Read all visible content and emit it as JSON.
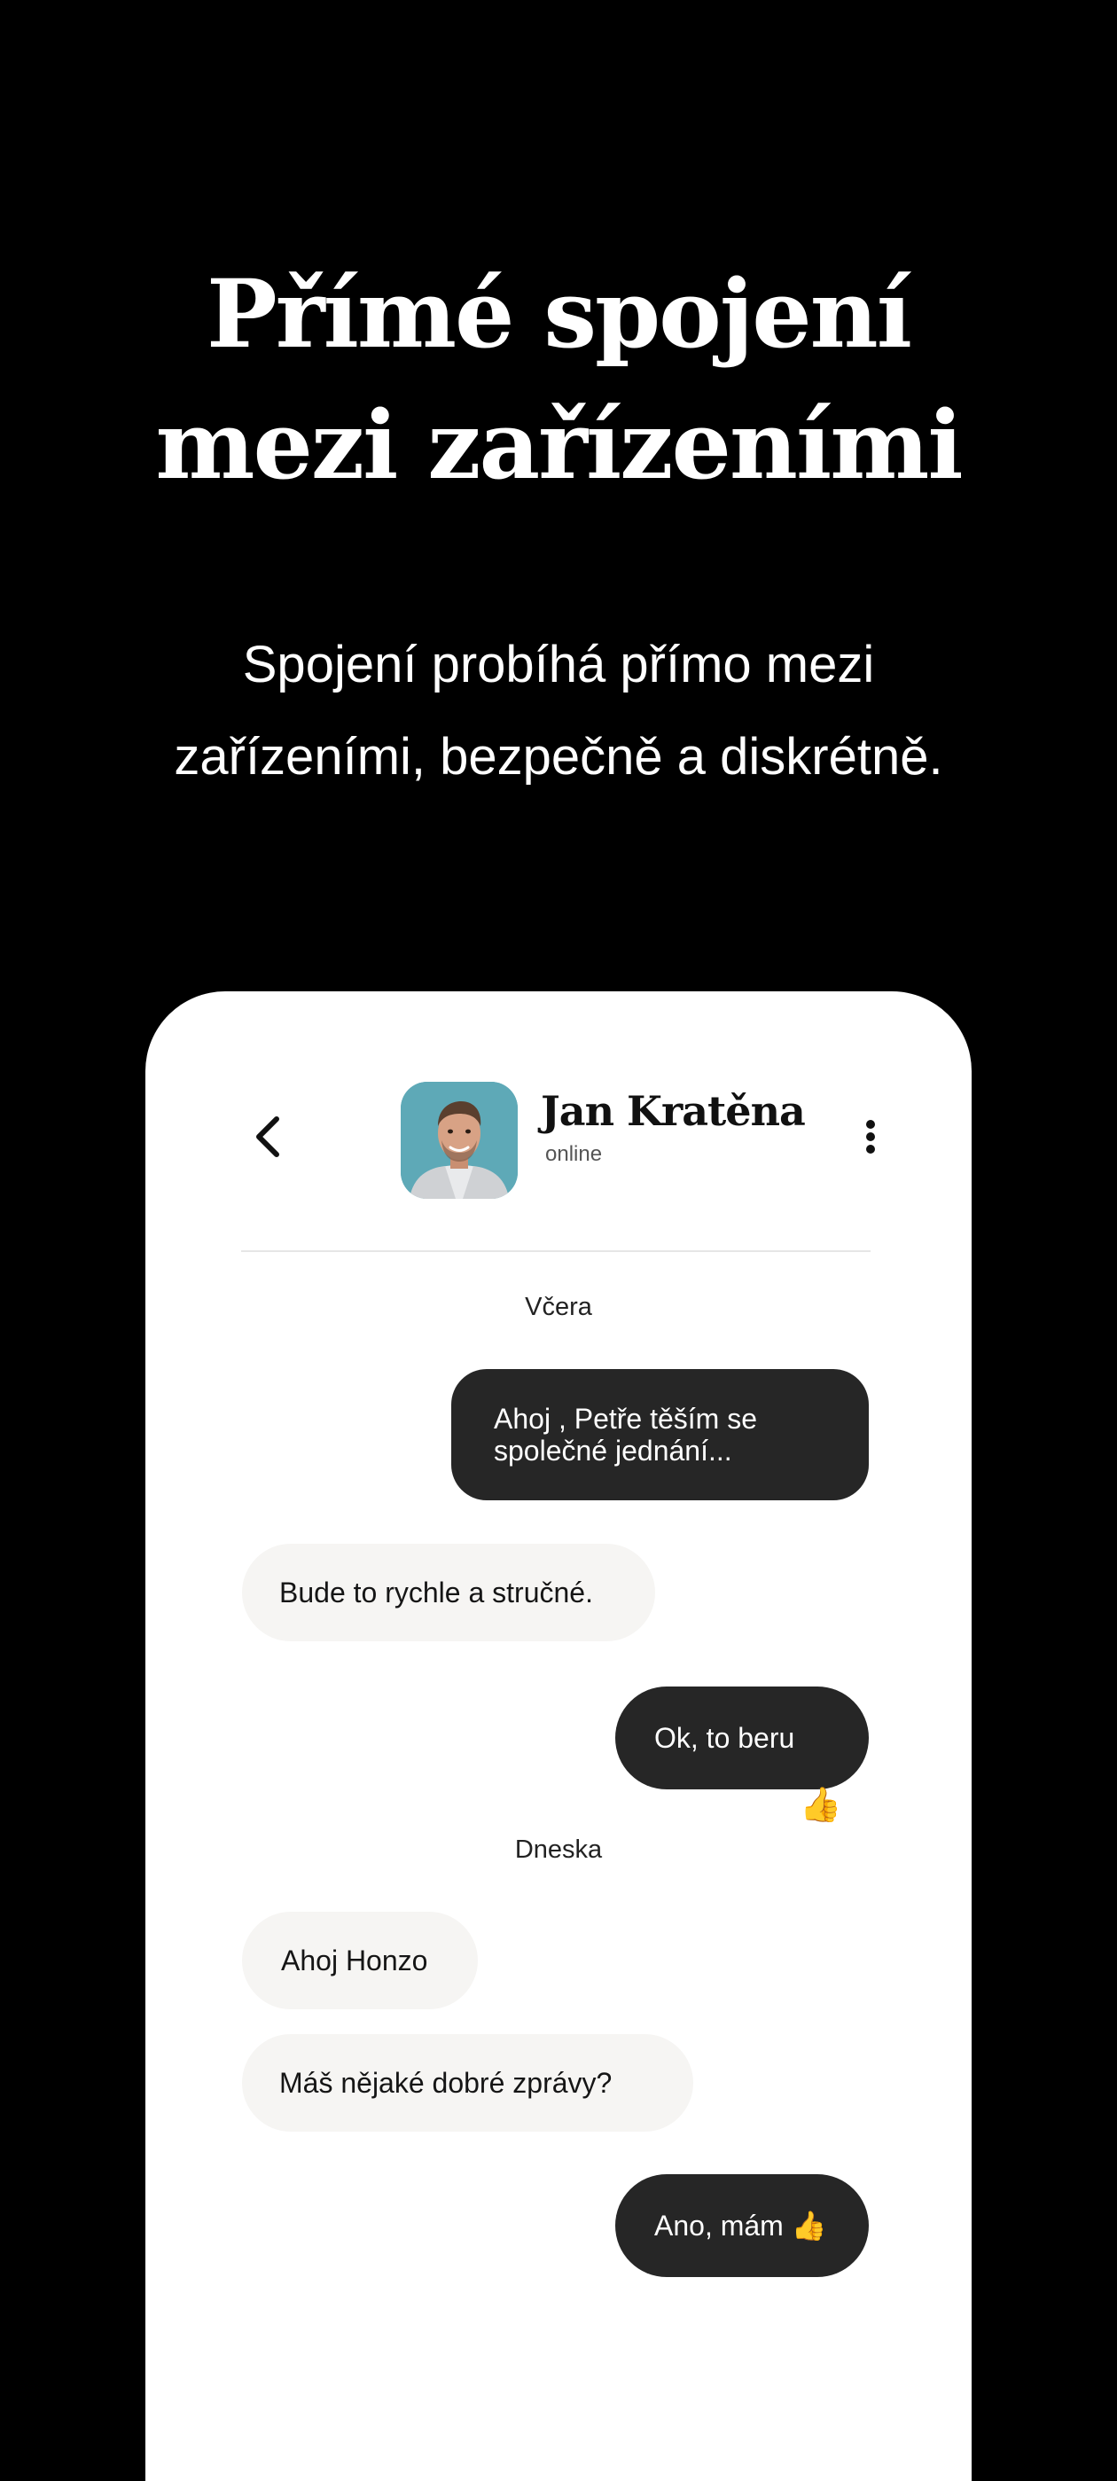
{
  "hero": {
    "title_line1": "Přímé spojení",
    "title_line2": "mezi zařízeními",
    "subtitle_line1": "Spojení probíhá přímo mezi",
    "subtitle_line2": "zařízeními, bezpečně a diskrétně."
  },
  "chat": {
    "contact_name": "Jan Kratěna",
    "contact_status": "online",
    "icons": {
      "back": "chevron-left-icon",
      "more": "more-vertical-icon"
    },
    "days": {
      "yesterday": "Včera",
      "today": "Dneska"
    },
    "messages": {
      "m1": "Ahoj , Petře těším se společné jednání...",
      "m2": "Bude to rychle a stručné.",
      "m3": "Ok, to beru",
      "m3_reaction": "👍",
      "m4": "Ahoj Honzo",
      "m5": "Máš nějaké dobré zprávy?",
      "m6": "Ano, mám 👍"
    },
    "colors": {
      "outgoing_bubble": "#262626",
      "incoming_bubble": "#f6f5f3",
      "background": "#000000"
    }
  }
}
